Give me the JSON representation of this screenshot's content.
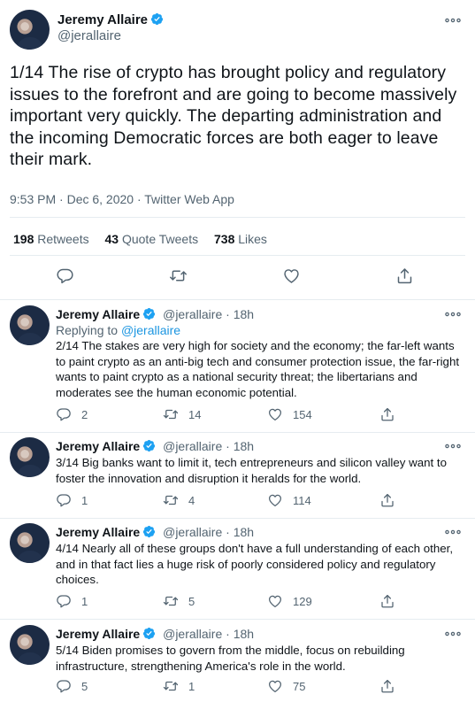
{
  "main_tweet": {
    "author_name": "Jeremy Allaire",
    "author_handle": "@jerallaire",
    "text": "1/14 The rise of crypto has brought policy and regulatory issues to the forefront and are going to become massively important very quickly.  The departing administration and the incoming Democratic forces are both eager to leave their mark.",
    "meta": "9:53 PM · Dec 6, 2020 · Twitter Web App",
    "retweets_count": "198",
    "retweets_label": "Retweets",
    "quotes_count": "43",
    "quotes_label": "Quote Tweets",
    "likes_count": "738",
    "likes_label": "Likes"
  },
  "replies": [
    {
      "author_name": "Jeremy Allaire",
      "author_handle": "@jerallaire",
      "time": "18h",
      "replying_prefix": "Replying to",
      "replying_to": "@jerallaire",
      "text": "2/14 The stakes are very high for society and the economy; the far-left wants to paint crypto as an anti-big tech and consumer protection issue, the far-right wants to paint crypto as a national security threat; the libertarians and moderates see the human economic potential.",
      "reply_count": "2",
      "retweet_count": "14",
      "like_count": "154"
    },
    {
      "author_name": "Jeremy Allaire",
      "author_handle": "@jerallaire",
      "time": "18h",
      "text": "3/14 Big banks want to limit it, tech entrepreneurs and silicon valley want to foster the innovation and disruption it heralds for the world.",
      "reply_count": "1",
      "retweet_count": "4",
      "like_count": "114"
    },
    {
      "author_name": "Jeremy Allaire",
      "author_handle": "@jerallaire",
      "time": "18h",
      "text": "4/14 Nearly all of these groups don't have a full understanding of each other, and in that fact lies a huge risk of poorly considered policy and regulatory choices.",
      "reply_count": "1",
      "retweet_count": "5",
      "like_count": "129"
    },
    {
      "author_name": "Jeremy Allaire",
      "author_handle": "@jerallaire",
      "time": "18h",
      "text": "5/14 Biden promises to govern from the middle, focus on rebuilding infrastructure, strengthening America's role in the world.",
      "reply_count": "5",
      "retweet_count": "1",
      "like_count": "75"
    }
  ],
  "icons": {
    "verified": "verified-badge-icon",
    "more": "more-dots-icon",
    "reply": "reply-bubble-icon",
    "retweet": "retweet-arrows-icon",
    "like": "heart-icon",
    "share": "share-upload-icon"
  },
  "colors": {
    "accent": "#1da1f2",
    "link": "#1b95e0",
    "text": "#0f1419",
    "secondary": "#536471",
    "divider": "#e6ecf0"
  }
}
